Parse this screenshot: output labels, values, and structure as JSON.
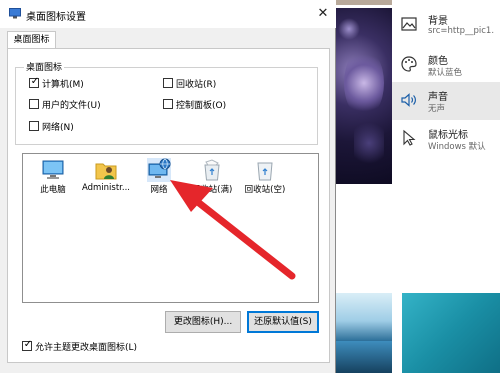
{
  "dialog": {
    "title": "桌面图标设置",
    "close_glyph": "✕",
    "tab_label": "桌面图标",
    "group_label": "桌面图标",
    "checkboxes": [
      {
        "label": "计算机(M)",
        "checked": true
      },
      {
        "label": "回收站(R)",
        "checked": false
      },
      {
        "label": "用户的文件(U)",
        "checked": false
      },
      {
        "label": "控制面板(O)",
        "checked": false
      },
      {
        "label": "网络(N)",
        "checked": false
      }
    ],
    "icons": [
      {
        "name": "此电脑",
        "icon": "monitor-icon"
      },
      {
        "name": "Administr...",
        "icon": "user-folder-icon"
      },
      {
        "name": "网络",
        "icon": "network-icon"
      },
      {
        "name": "回收站(满)",
        "icon": "recycle-bin-full-icon"
      },
      {
        "name": "回收站(空)",
        "icon": "recycle-bin-empty-icon"
      }
    ],
    "change_icon_label": "更改图标(H)...",
    "restore_default_label": "还原默认值(S)",
    "allow_theme_label": "允许主题更改桌面图标(L)",
    "allow_theme_checked": true
  },
  "settings": {
    "items": [
      {
        "title": "背景",
        "subtitle": "src=http__pic1.",
        "icon": "picture-icon"
      },
      {
        "title": "颜色",
        "subtitle": "默认蓝色",
        "icon": "palette-icon"
      },
      {
        "title": "声音",
        "subtitle": "无声",
        "icon": "speaker-icon"
      },
      {
        "title": "鼠标光标",
        "subtitle": "Windows 默认",
        "icon": "cursor-icon"
      }
    ]
  },
  "colors": {
    "accent": "#0078d7",
    "annotation_arrow": "#e5262b"
  }
}
